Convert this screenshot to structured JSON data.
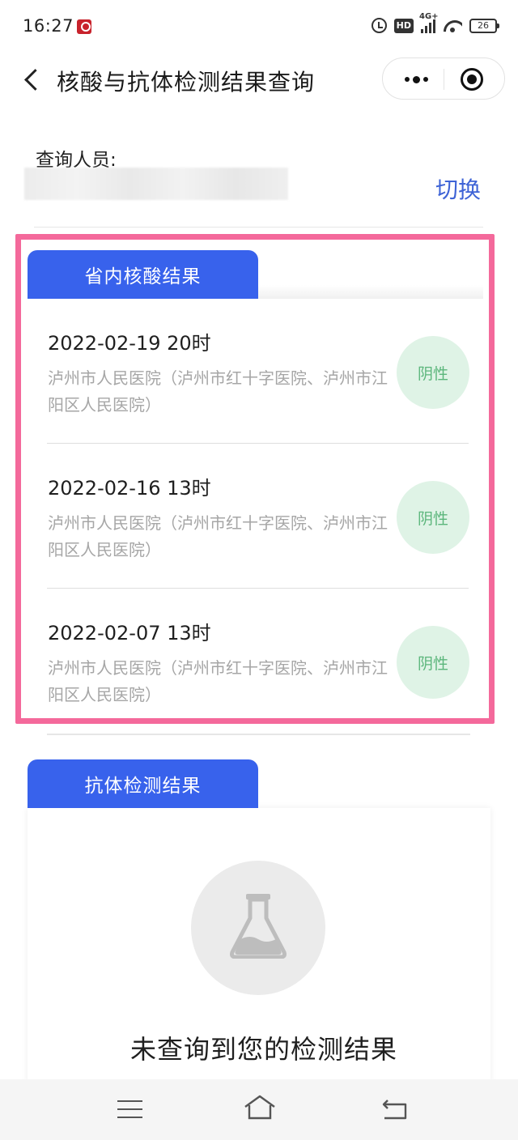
{
  "status_bar": {
    "time": "16:27",
    "network": "4G+",
    "hd": "HD",
    "battery": "26"
  },
  "nav": {
    "title": "核酸与抗体检测结果查询"
  },
  "person": {
    "label": "查询人员:",
    "switch_label": "切换"
  },
  "nucleic_section": {
    "tab_label": "省内核酸结果",
    "results": [
      {
        "datetime": "2022-02-19 20时",
        "hospital": "泸州市人民医院（泸州市红十字医院、泸州市江阳区人民医院）",
        "result": "阴性"
      },
      {
        "datetime": "2022-02-16 13时",
        "hospital": "泸州市人民医院（泸州市红十字医院、泸州市江阳区人民医院）",
        "result": "阴性"
      },
      {
        "datetime": "2022-02-07 13时",
        "hospital": "泸州市人民医院（泸州市红十字医院、泸州市江阳区人民医院）",
        "result": "阴性"
      }
    ]
  },
  "antibody_section": {
    "tab_label": "抗体检测结果",
    "empty_icon": "flask-icon",
    "empty_text": "未查询到您的检测结果"
  },
  "colors": {
    "accent_blue": "#3862ec",
    "link_blue": "#3e63d6",
    "negative_green": "#5cb67c",
    "negative_bg": "#dff3e6",
    "highlight_pink": "#f4699b"
  }
}
